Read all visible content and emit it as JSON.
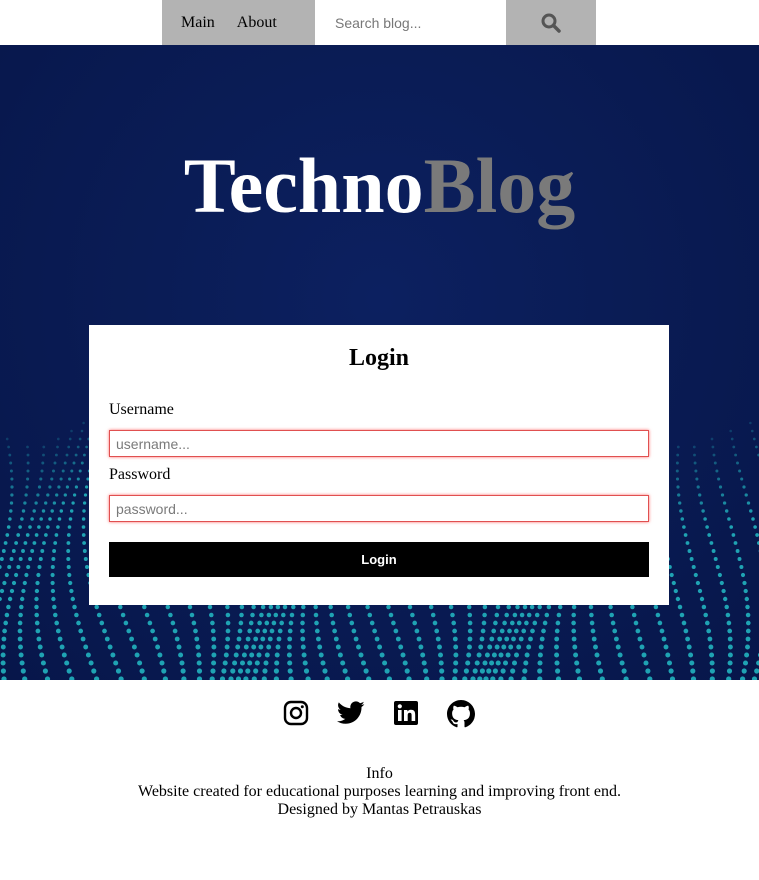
{
  "nav": {
    "items": [
      "Main",
      "About"
    ],
    "search_placeholder": "Search blog...",
    "search_icon": "search-icon"
  },
  "hero": {
    "brand_first": "Techno",
    "brand_second": "Blog"
  },
  "login": {
    "title": "Login",
    "username_label": "Username",
    "username_placeholder": "username...",
    "password_label": "Password",
    "password_placeholder": "password...",
    "submit_label": "Login"
  },
  "footer": {
    "social_icons": [
      "instagram-icon",
      "twitter-icon",
      "linkedin-icon",
      "github-icon"
    ],
    "info_title": "Info",
    "info_text": "Website created for educational purposes learning and improving front end.",
    "designer": "Designed by Mantas Petrauskas"
  },
  "colors": {
    "hero_background": "#0a1c55",
    "nav_gray": "#b3b3b3",
    "dot_teal": "#1fa3b3",
    "brand_gray": "#7a7a7a",
    "field_error_border": "#e05050",
    "button_black": "#000000"
  }
}
